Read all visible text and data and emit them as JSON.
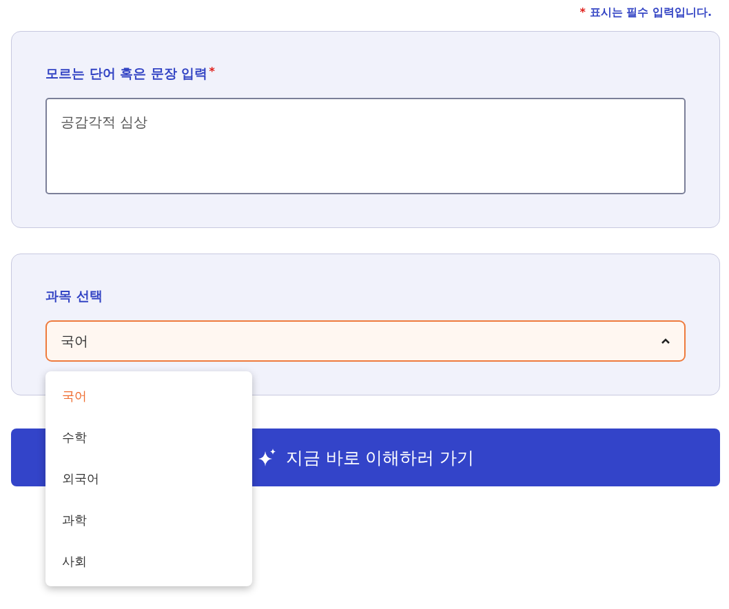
{
  "required_note": {
    "mark": "*",
    "text": "표시는 필수 입력입니다."
  },
  "question": {
    "label": "모르는 단어 혹은 문장 입력",
    "required_mark": "*",
    "value": "공감각적 심상"
  },
  "subject": {
    "label": "과목 선택",
    "value": "국어",
    "expanded": true,
    "options": [
      {
        "label": "국어",
        "selected": true
      },
      {
        "label": "수학",
        "selected": false
      },
      {
        "label": "외국어",
        "selected": false
      },
      {
        "label": "과학",
        "selected": false
      },
      {
        "label": "사회",
        "selected": false
      }
    ]
  },
  "submit": {
    "label": "지금 바로 이해하러 가기"
  }
}
